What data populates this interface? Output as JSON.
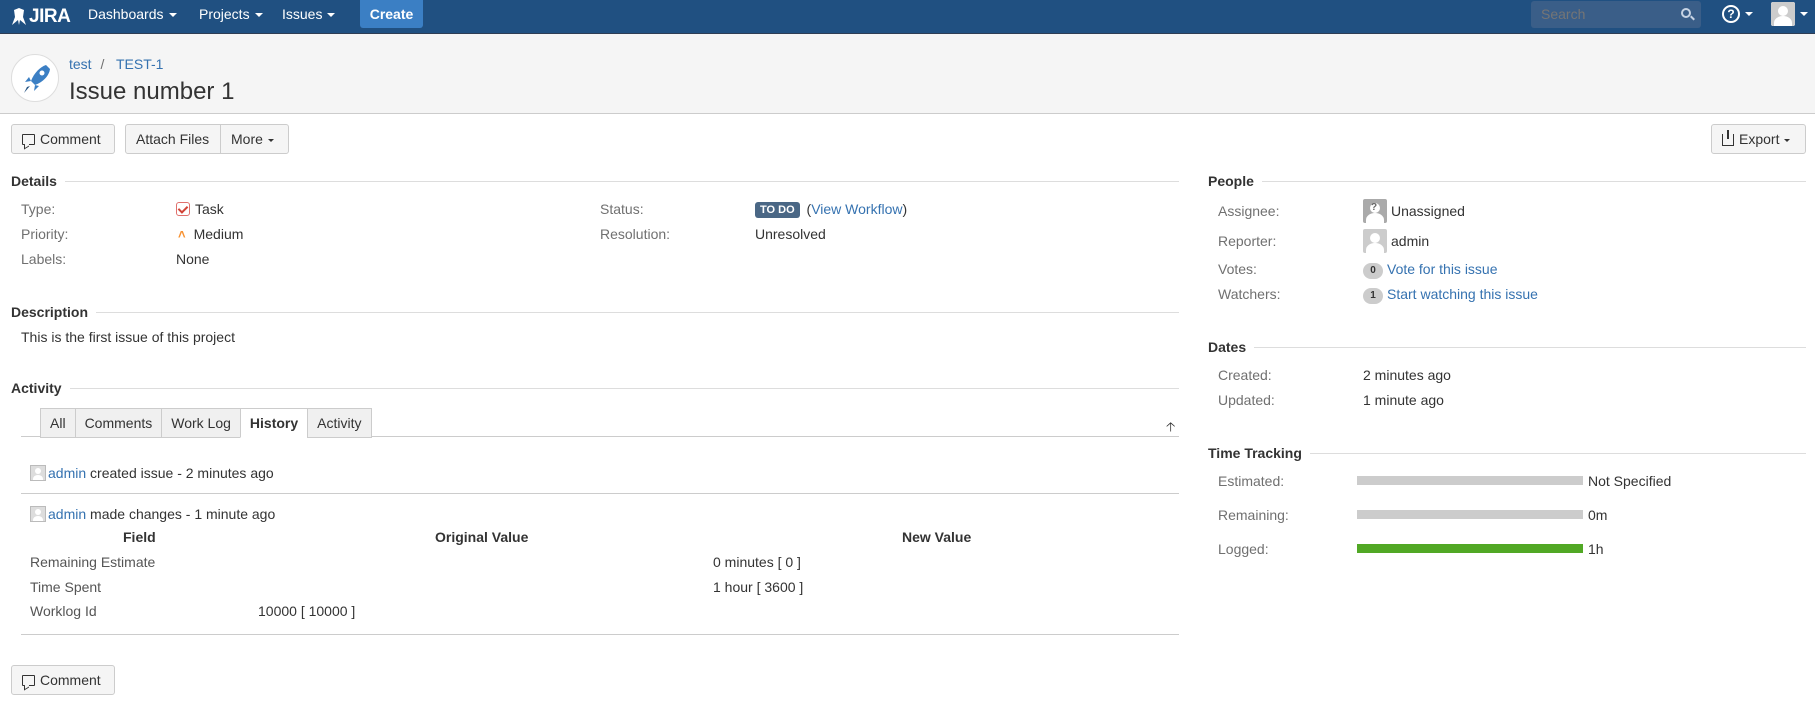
{
  "header": {
    "logo": "JIRA",
    "nav": [
      {
        "label": "Dashboards"
      },
      {
        "label": "Projects"
      },
      {
        "label": "Issues"
      }
    ],
    "create_label": "Create",
    "search_placeholder": "Search",
    "help_glyph": "?"
  },
  "breadcrumb": {
    "project": "test",
    "separator": "/",
    "issue_key": "TEST-1"
  },
  "issue": {
    "title": "Issue number 1"
  },
  "toolbar": {
    "comment_label": "Comment",
    "attach_label": "Attach Files",
    "more_label": "More",
    "export_label": "Export"
  },
  "details": {
    "heading": "Details",
    "type_label": "Type:",
    "type_value": "Task",
    "priority_label": "Priority:",
    "priority_value": "Medium",
    "labels_label": "Labels:",
    "labels_value": "None",
    "status_label": "Status:",
    "status_value": "TO DO",
    "status_paren_open": "(",
    "view_workflow": "View Workflow",
    "status_paren_close": ")",
    "resolution_label": "Resolution:",
    "resolution_value": "Unresolved"
  },
  "description": {
    "heading": "Description",
    "text": "This is the first issue of this project"
  },
  "activity": {
    "heading": "Activity",
    "tabs": [
      "All",
      "Comments",
      "Work Log",
      "History",
      "Activity"
    ],
    "active_tab": "History",
    "entries": [
      {
        "user": "admin",
        "action": " created issue - 2 minutes ago"
      },
      {
        "user": "admin",
        "action": " made changes - 1 minute ago"
      }
    ],
    "history_table": {
      "headers": [
        "Field",
        "Original Value",
        "New Value"
      ],
      "rows": [
        {
          "field": "Remaining Estimate",
          "original": "",
          "new": "0 minutes [ 0 ]"
        },
        {
          "field": "Time Spent",
          "original": "",
          "new": "1 hour [ 3600 ]"
        },
        {
          "field": "Worklog Id",
          "original": "10000 [ 10000 ]",
          "new": ""
        }
      ]
    },
    "bottom_comment_label": "Comment"
  },
  "people": {
    "heading": "People",
    "assignee_label": "Assignee:",
    "assignee_value": "Unassigned",
    "reporter_label": "Reporter:",
    "reporter_value": "admin",
    "votes_label": "Votes:",
    "votes_count": "0",
    "votes_link": "Vote for this issue",
    "watchers_label": "Watchers:",
    "watchers_count": "1",
    "watchers_link": "Start watching this issue"
  },
  "dates": {
    "heading": "Dates",
    "created_label": "Created:",
    "created_value": "2 minutes ago",
    "updated_label": "Updated:",
    "updated_value": "1 minute ago"
  },
  "time_tracking": {
    "heading": "Time Tracking",
    "estimated_label": "Estimated:",
    "estimated_value": "Not Specified",
    "estimated_fill": 0,
    "remaining_label": "Remaining:",
    "remaining_value": "0m",
    "remaining_fill": 0,
    "logged_label": "Logged:",
    "logged_value": "1h",
    "logged_fill": 1.0,
    "logged_color": "#51a825",
    "empty_color": "#cccccc"
  },
  "colors": {
    "header_bg": "#205081",
    "create_bg": "#3b7fc4",
    "link": "#3572b0",
    "status_lozenge": "#4a6785"
  }
}
